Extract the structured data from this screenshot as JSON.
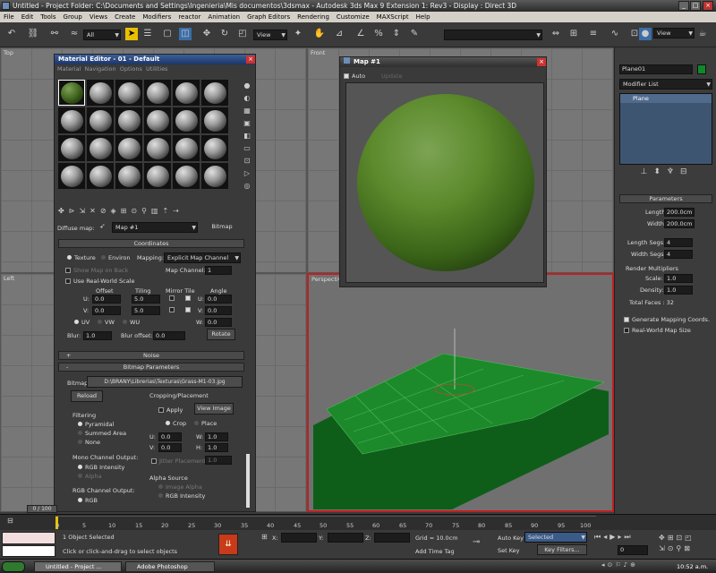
{
  "window": {
    "title": "Untitled    - Project Folder: C:\\Documents and Settings\\Ingenieria\\Mis documentos\\3dsmax    - Autodesk 3ds Max 9 Extension 1: Rev3    - Display : Direct 3D"
  },
  "menu": [
    "File",
    "Edit",
    "Tools",
    "Group",
    "Views",
    "Create",
    "Modifiers",
    "reactor",
    "Animation",
    "Graph Editors",
    "Rendering",
    "Customize",
    "MAXScript",
    "Help"
  ],
  "toolbar": {
    "selection_filter": "All",
    "view1": "View",
    "view2": "View"
  },
  "viewports": {
    "top": "Top",
    "front": "Front",
    "left": "Left",
    "perspective": "Perspective"
  },
  "material_editor": {
    "title": "Material Editor - 01 - Default",
    "menu": [
      "Material",
      "Navigation",
      "Options",
      "Utilities"
    ],
    "diffuse_label": "Diffuse map:",
    "map_name": "Map #1",
    "bitmap_button": "Bitmap",
    "coordinates": {
      "header": "Coordinates",
      "texture": "Texture",
      "environ": "Environ",
      "mapping_label": "Mapping:",
      "mapping_value": "Explicit Map Channel",
      "show_map_on_back": "Show Map on Back",
      "map_channel_label": "Map Channel:",
      "map_channel_value": "1",
      "use_real_world": "Use Real-World Scale",
      "offset": "Offset",
      "tiling": "Tiling",
      "mirror_tile": "Mirror Tile",
      "angle": "Angle",
      "u_offset": "0.0",
      "v_offset": "0.0",
      "u_tiling": "5.0",
      "v_tiling": "5.0",
      "u_angle": "0.0",
      "v_angle": "0.0",
      "w_angle": "0.0",
      "uv": "UV",
      "vw": "VW",
      "wu": "WU",
      "blur_label": "Blur:",
      "blur_value": "1.0",
      "blur_offset_label": "Blur offset:",
      "blur_offset_value": "0.0",
      "rotate": "Rotate"
    },
    "noise_header": "Noise",
    "bitmap_params": {
      "header": "Bitmap Parameters",
      "bitmap_label": "Bitmap:",
      "bitmap_path": "D:\\BRANY\\Librerias\\Texturas\\Grass-M1-03.jpg",
      "reload": "Reload",
      "cropping": "Cropping/Placement",
      "apply": "Apply",
      "view_image": "View Image",
      "crop": "Crop",
      "place": "Place",
      "filtering": "Filtering",
      "pyramidal": "Pyramidal",
      "summed_area": "Summed Area",
      "none": "None",
      "u_val": "0.0",
      "v_val": "0.0",
      "w_val": "1.0",
      "h_val": "1.0",
      "jitter": "Jitter Placement",
      "jitter_value": "1.0",
      "mono_output": "Mono Channel Output:",
      "rgb_intensity": "RGB Intensity",
      "alpha": "Alpha",
      "rgb_output": "RGB Channel Output:",
      "rgb": "RGB",
      "alpha_source": "Alpha Source",
      "image_alpha": "Image Alpha",
      "rgb_intensity2": "RGB Intensity"
    }
  },
  "map_window": {
    "title": "Map #1",
    "auto": "Auto",
    "update": "Update"
  },
  "command_panel": {
    "object_name": "Plane01",
    "modifier_list": "Modifier List",
    "stack_item": "Plane",
    "parameters_header": "Parameters",
    "length_label": "Length:",
    "length": "200.0cm",
    "width_label": "Width:",
    "width": "200.0cm",
    "length_segs_label": "Length Segs:",
    "length_segs": "4",
    "width_segs_label": "Width Segs:",
    "width_segs": "4",
    "render_mult": "Render Multipliers",
    "scale_label": "Scale:",
    "scale": "1.0",
    "density_label": "Density:",
    "density": "1.0",
    "total_faces": "Total Faces : 32",
    "gen_mapping": "Generate Mapping Coords.",
    "real_world": "Real-World Map Size"
  },
  "timeline": {
    "frame": "0 / 100",
    "ticks": [
      "0",
      "5",
      "10",
      "15",
      "20",
      "25",
      "30",
      "35",
      "40",
      "45",
      "50",
      "55",
      "60",
      "65",
      "70",
      "75",
      "80",
      "85",
      "90",
      "95",
      "100"
    ]
  },
  "status": {
    "selected": "1 Object Selected",
    "prompt": "Click or click-and-drag to select objects",
    "x": "X:",
    "y": "Y:",
    "z": "Z:",
    "grid": "Grid = 10.0cm",
    "add_time_tag": "Add Time Tag",
    "auto_key": "Auto Key",
    "set_key": "Set Key",
    "selected_dd": "Selected",
    "key_filters": "Key Filters...",
    "frame": "0"
  },
  "taskbar": {
    "item1": "Untitled  - Project ...",
    "item2": "Adobe Photoshop",
    "clock": "10:52 a.m."
  }
}
